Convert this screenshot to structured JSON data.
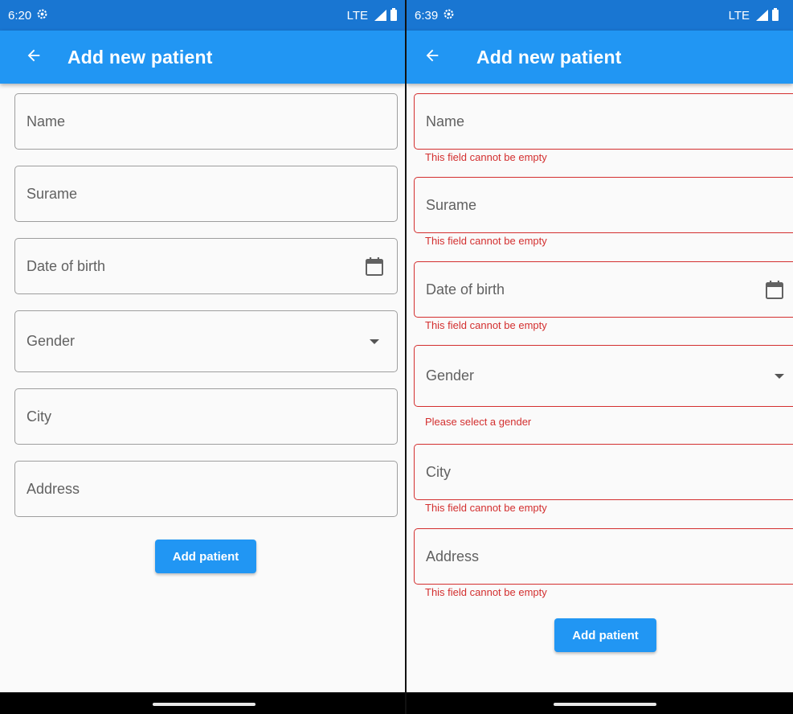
{
  "colors": {
    "status_bar": "#1976d2",
    "app_bar": "#2196f3",
    "error": "#d32f2f",
    "field_border": "#9e9e9e",
    "background": "#fafafa"
  },
  "left": {
    "status": {
      "time": "6:20",
      "network": "LTE"
    },
    "app_bar": {
      "title": "Add new patient",
      "back_icon": "arrow-left-icon"
    },
    "fields": {
      "name": {
        "label": "Name"
      },
      "surname": {
        "label": "Surame"
      },
      "dob": {
        "label": "Date of birth",
        "icon": "calendar-icon"
      },
      "gender": {
        "label": "Gender",
        "icon": "dropdown-arrow-icon"
      },
      "city": {
        "label": "City"
      },
      "address": {
        "label": "Address"
      }
    },
    "submit_label": "Add patient"
  },
  "right": {
    "status": {
      "time": "6:39",
      "network": "LTE"
    },
    "app_bar": {
      "title": "Add new patient",
      "back_icon": "arrow-left-icon"
    },
    "fields": {
      "name": {
        "label": "Name",
        "error": "This field cannot be empty"
      },
      "surname": {
        "label": "Surame",
        "error": "This field cannot be empty"
      },
      "dob": {
        "label": "Date of birth",
        "icon": "calendar-icon",
        "error": "This field cannot be empty"
      },
      "gender": {
        "label": "Gender",
        "icon": "dropdown-arrow-icon",
        "error": "Please select a gender"
      },
      "city": {
        "label": "City",
        "error": "This field cannot be empty"
      },
      "address": {
        "label": "Address",
        "error": "This field cannot be empty"
      }
    },
    "submit_label": "Add patient"
  }
}
